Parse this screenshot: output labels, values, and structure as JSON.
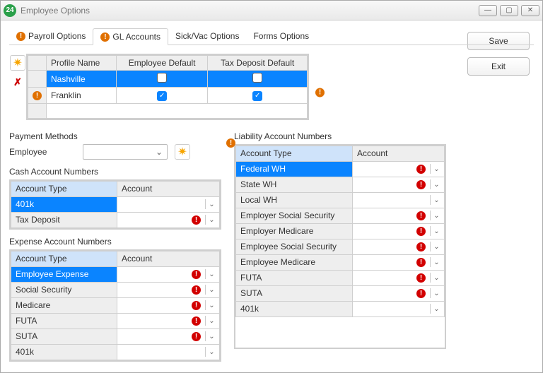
{
  "window": {
    "title": "Employee Options",
    "icon_text": "24"
  },
  "tabs": {
    "payroll": "Payroll Options",
    "gl": "GL Accounts",
    "sickvac": "Sick/Vac Options",
    "forms": "Forms Options"
  },
  "profile": {
    "headers": {
      "name": "Profile Name",
      "emp_default": "Employee Default",
      "tax_default": "Tax Deposit Default"
    },
    "rows": [
      {
        "name": "Nashville",
        "emp_default": false,
        "tax_default": false,
        "selected": true,
        "warn": false
      },
      {
        "name": "Franklin",
        "emp_default": true,
        "tax_default": true,
        "selected": false,
        "warn": true
      }
    ]
  },
  "payment_methods": {
    "label": "Payment Methods",
    "employee_label": "Employee",
    "employee_value": ""
  },
  "cash": {
    "label": "Cash Account Numbers",
    "headers": {
      "type": "Account Type",
      "account": "Account"
    },
    "rows": [
      {
        "type": "401k",
        "account": "",
        "err": false,
        "dd": true,
        "selected": true
      },
      {
        "type": "Tax Deposit",
        "account": "",
        "err": true,
        "dd": true
      }
    ]
  },
  "expense": {
    "label": "Expense Account Numbers",
    "headers": {
      "type": "Account Type",
      "account": "Account"
    },
    "rows": [
      {
        "type": "Employee Expense",
        "account": "",
        "err": true,
        "dd": true,
        "selected": true
      },
      {
        "type": "Social Security",
        "account": "",
        "err": true,
        "dd": true
      },
      {
        "type": "Medicare",
        "account": "",
        "err": true,
        "dd": true
      },
      {
        "type": "FUTA",
        "account": "",
        "err": true,
        "dd": true
      },
      {
        "type": "SUTA",
        "account": "",
        "err": true,
        "dd": true
      },
      {
        "type": "401k",
        "account": "",
        "err": false,
        "dd": true
      }
    ]
  },
  "liability": {
    "label": "Liability Account Numbers",
    "headers": {
      "type": "Account Type",
      "account": "Account"
    },
    "rows": [
      {
        "type": "Federal WH",
        "account": "",
        "err": true,
        "dd": true,
        "selected": true
      },
      {
        "type": "State WH",
        "account": "",
        "err": true,
        "dd": true
      },
      {
        "type": "Local WH",
        "account": "",
        "err": false,
        "dd": true
      },
      {
        "type": "Employer Social Security",
        "account": "",
        "err": true,
        "dd": true
      },
      {
        "type": "Employer Medicare",
        "account": "",
        "err": true,
        "dd": true
      },
      {
        "type": "Employee Social Security",
        "account": "",
        "err": true,
        "dd": true
      },
      {
        "type": "Employee Medicare",
        "account": "",
        "err": true,
        "dd": true
      },
      {
        "type": "FUTA",
        "account": "",
        "err": true,
        "dd": true
      },
      {
        "type": "SUTA",
        "account": "",
        "err": true,
        "dd": true
      },
      {
        "type": "401k",
        "account": "",
        "err": false,
        "dd": true
      }
    ]
  },
  "buttons": {
    "save": "Save",
    "exit": "Exit"
  }
}
